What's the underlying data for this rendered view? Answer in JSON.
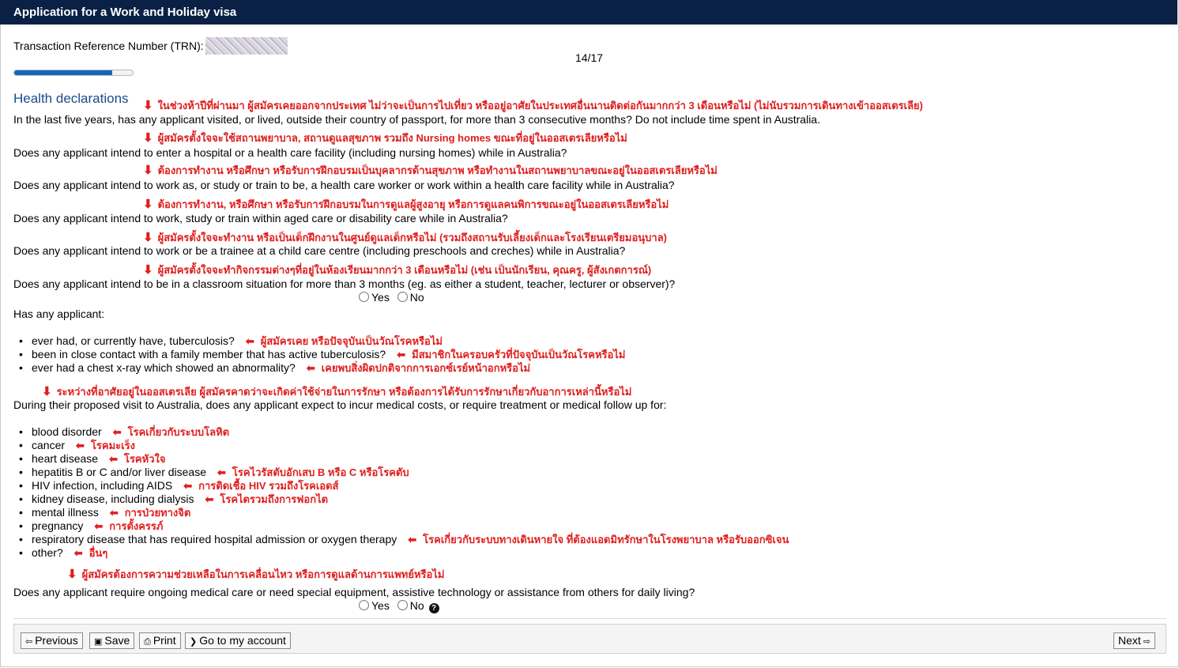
{
  "title": "Application for a Work and Holiday visa",
  "trn_label": "Transaction Reference Number (TRN):",
  "progress": {
    "label": "14/17",
    "fraction": 0.8235
  },
  "section_title": "Health declarations",
  "questions": [
    {
      "annotation": "ในช่วงห้าปีที่ผ่านมา ผู้สมัครเคยออกจากประเทศ ไม่ว่าจะเป็นการไปเที่ยว หรืออยู่อาศัยในประเทศอื่นนานติดต่อกันมากกว่า 3 เดือนหรือไม่ (ไม่นับรวมการเดินทางเข้าออสเตรเลีย)",
      "text": "In the last five years, has any applicant visited, or lived, outside their country of passport, for more than 3 consecutive months? Do not include time spent in Australia."
    },
    {
      "annotation": "ผู้สมัครตั้งใจจะใช้สถานพยาบาล, สถานดูแลสุขภาพ รวมถึง Nursing homes ขณะที่อยู่ในออสเตรเลียหรือไม่",
      "text": "Does any applicant intend to enter a hospital or a health care facility (including nursing homes) while in Australia?"
    },
    {
      "annotation": "ต้องการทำงาน หรือศึกษา หรือรับการฝึกอบรมเป็นบุคลากรด้านสุขภาพ หรือทำงานในสถานพยาบาลขณะอยู่ในออสเตรเลียหรือไม่",
      "text": "Does any applicant intend to work as, or study or train to be, a health care worker or work within a health care facility while in Australia?"
    },
    {
      "annotation": "ต้องการทำงาน, หรือศึกษา หรือรับการฝึกอบรมในการดูแลผู้สูงอายุ หรือการดูแลคนพิการขณะอยู่ในออสเตรเลียหรือไม่",
      "text": "Does any applicant intend to work, study or train within aged care or disability care while in Australia?"
    },
    {
      "annotation": "ผู้สมัครตั้งใจจะทำงาน หรือเป็นเด็กฝึกงานในศูนย์ดูแลเด็กหรือไม่ (รวมถึงสถานรับเลี้ยงเด็กและโรงเรียนเตรียมอนุบาล)",
      "text": "Does any applicant intend to work or be a trainee at a child care centre (including preschools and creches) while in Australia?"
    },
    {
      "annotation": "ผู้สมัครตั้งใจจะทำกิจกรรมต่างๆที่อยู่ในห้องเรียนมากกว่า 3 เดือนหรือไม่ (เช่น เป็นนักเรียน, คุณครู, ผู้สังเกตการณ์)",
      "text": "Does any applicant intend to be in a classroom situation for more than 3 months (eg. as either a student, teacher, lecturer or observer)?"
    }
  ],
  "radio": {
    "yes": "Yes",
    "no": "No"
  },
  "has_any_applicant": "Has any applicant:",
  "tb_items": [
    {
      "text": "ever had, or currently have, tuberculosis?",
      "annotation": "ผู้สมัครเคย หรือปัจจุบันเป็นวัณโรคหรือไม่"
    },
    {
      "text": "been in close contact with a family member that has active tuberculosis?",
      "annotation": "มีสมาชิกในครอบครัวที่ปัจจุบันเป็นวัณโรคหรือไม่"
    },
    {
      "text": "ever had a chest x-ray which showed an abnormality?",
      "annotation": "เคยพบสิ่งผิดปกติจากการเอกซ์เรย์หน้าอกหรือไม่"
    }
  ],
  "medical_costs": {
    "annotation": "ระหว่างที่อาศัยอยู่ในออสเตรเลีย ผู้สมัครคาดว่าจะเกิดค่าใช้จ่ายในการรักษา หรือต้องการได้รับการรักษาเกี่ยวกับอาการเหล่านี้หรือไม่",
    "text": "During their proposed visit to Australia, does any applicant expect to incur medical costs, or require treatment or medical follow up for:"
  },
  "conditions": [
    {
      "text": "blood disorder",
      "annotation": "โรคเกี่ยวกับระบบโลหิต"
    },
    {
      "text": "cancer",
      "annotation": "โรคมะเร็ง"
    },
    {
      "text": "heart disease",
      "annotation": "โรคหัวใจ"
    },
    {
      "text": "hepatitis B or C and/or liver disease",
      "annotation": "โรคไวรัสตับอักเสบ B หรือ C หรือโรคตับ"
    },
    {
      "text": "HIV infection, including AIDS",
      "annotation": "การติดเชื้อ HIV รวมถึงโรคเอดส์"
    },
    {
      "text": "kidney disease, including dialysis",
      "annotation": "โรคไตรวมถึงการฟอกไต"
    },
    {
      "text": "mental illness",
      "annotation": "การป่วยทางจิต"
    },
    {
      "text": "pregnancy",
      "annotation": "การตั้งครรภ์"
    },
    {
      "text": "respiratory disease that has required hospital admission or oxygen therapy",
      "annotation": "โรคเกี่ยวกับระบบทางเดินหายใจ ที่ต้องแอดมิทรักษาในโรงพยาบาล หรือรับออกซิเจน"
    },
    {
      "text": "other?",
      "annotation": "อื่นๆ"
    }
  ],
  "ongoing_care": {
    "annotation": "ผู้สมัครต้องการความช่วยเหลือในการเคลื่อนไหว หรือการดูแลด้านการแพทย์หรือไม่",
    "text": "Does any applicant require ongoing medical care or need special equipment, assistive technology or assistance from others for daily living?"
  },
  "buttons": {
    "previous": "Previous",
    "save": "Save",
    "print": "Print",
    "account": "Go to my account",
    "next": "Next"
  }
}
